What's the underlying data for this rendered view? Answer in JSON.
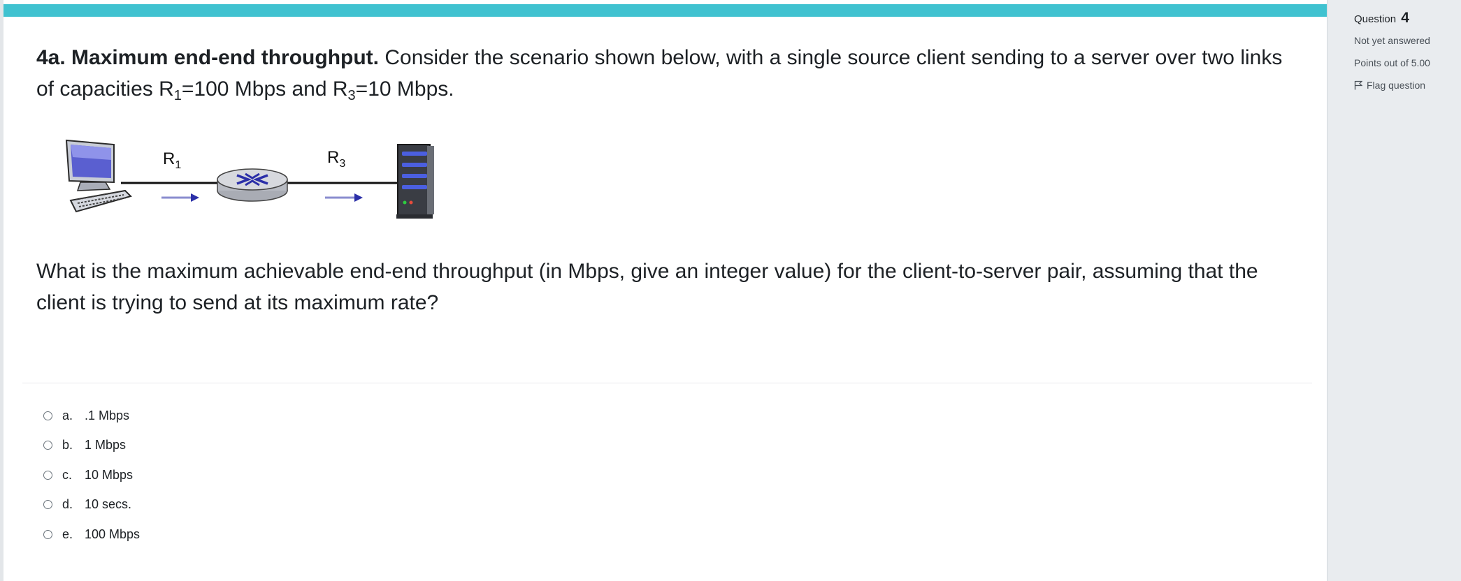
{
  "question": {
    "title_bold": "4a. Maximum end-end throughput.",
    "stem_part1": " Consider the scenario shown below, with a single source client sending to a server over two links of capacities R",
    "r1_sub": "1",
    "stem_part2": "=100 Mbps and R",
    "r3_sub": "3",
    "stem_part3": "=10 Mbps.",
    "prompt": "What is the maximum achievable end-end throughput (in Mbps, give an integer value) for the client-to-server pair, assuming that the client is trying to send at its maximum rate?"
  },
  "diagram": {
    "link1_label": "R",
    "link1_sub": "1",
    "link2_label": "R",
    "link2_sub": "3",
    "client_icon": "desktop-computer-icon",
    "router_icon": "router-icon",
    "server_icon": "server-tower-icon",
    "arrow_color": "#2b2fa8"
  },
  "options": [
    {
      "letter": "a.",
      "text": ".1 Mbps"
    },
    {
      "letter": "b.",
      "text": "1 Mbps"
    },
    {
      "letter": "c.",
      "text": "10 Mbps"
    },
    {
      "letter": "d.",
      "text": "10 secs."
    },
    {
      "letter": "e.",
      "text": "100 Mbps"
    }
  ],
  "sidebar": {
    "question_label": "Question",
    "question_number": "4",
    "status": "Not yet answered",
    "points": "Points out of 5.00",
    "flag_label": "Flag question",
    "flag_icon": "flag-outline-icon"
  },
  "colors": {
    "accent": "#40c2d0",
    "sidebar_bg": "#e9ecef"
  }
}
